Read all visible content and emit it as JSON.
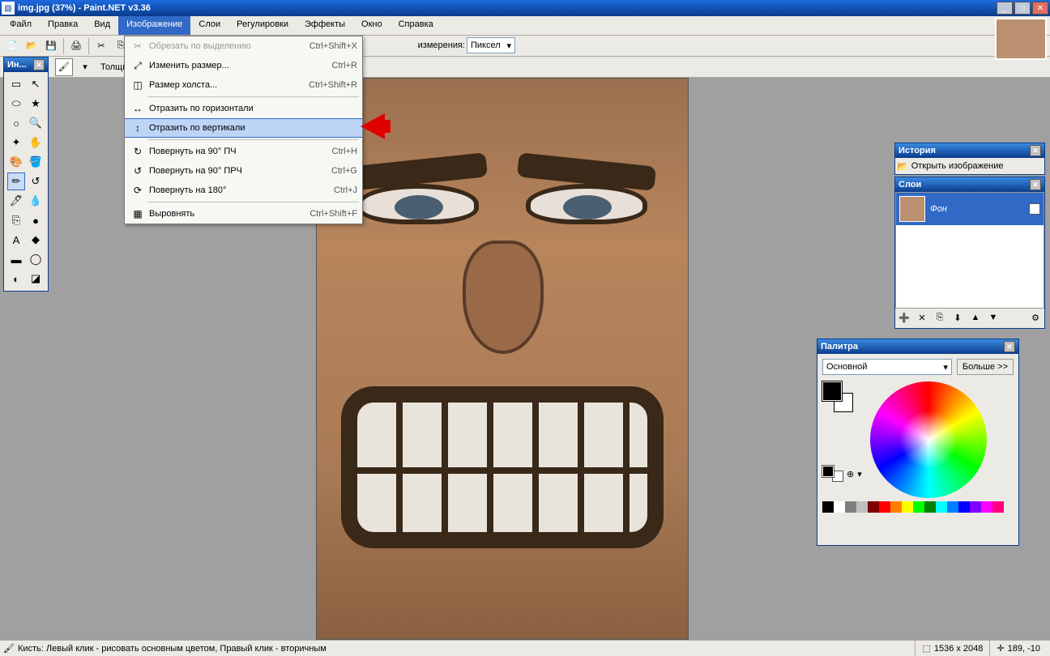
{
  "title": "img.jpg (37%) - Paint.NET v3.36",
  "menubar": [
    "Файл",
    "Правка",
    "Вид",
    "Изображение",
    "Слои",
    "Регулировки",
    "Эффекты",
    "Окно",
    "Справка"
  ],
  "active_menu_index": 3,
  "toolbar": {
    "unit_label": "измерения:",
    "unit_value": "Пиксел"
  },
  "secondbar": {
    "label": "Толщина"
  },
  "tools_panel": {
    "title": "Ин..."
  },
  "tools": [
    "▭",
    "↖",
    "⬭",
    "★",
    "○",
    "🔍",
    "✦",
    "✋",
    "🎨",
    "🪣",
    "✏",
    "↺",
    "🖊",
    "💧",
    "⎘",
    "●",
    "A",
    "◆",
    "▬",
    "◯",
    "◐",
    "◪"
  ],
  "dropdown": {
    "items": [
      {
        "icon": "✂",
        "label": "Обрезать по выделению",
        "shortcut": "Ctrl+Shift+X",
        "disabled": true
      },
      {
        "icon": "⤢",
        "label": "Изменить размер...",
        "shortcut": "Ctrl+R"
      },
      {
        "icon": "◫",
        "label": "Размер холста...",
        "shortcut": "Ctrl+Shift+R"
      },
      {
        "sep": true
      },
      {
        "icon": "↔",
        "label": "Отразить по горизонтали",
        "shortcut": ""
      },
      {
        "icon": "↕",
        "label": "Отразить по вертикали",
        "shortcut": "",
        "highlight": true
      },
      {
        "sep": true
      },
      {
        "icon": "↻",
        "label": "Повернуть на 90° ПЧ",
        "shortcut": "Ctrl+H"
      },
      {
        "icon": "↺",
        "label": "Повернуть на 90° ПРЧ",
        "shortcut": "Ctrl+G"
      },
      {
        "icon": "⟳",
        "label": "Повернуть на 180°",
        "shortcut": "Ctrl+J"
      },
      {
        "sep": true
      },
      {
        "icon": "▦",
        "label": "Выровнять",
        "shortcut": "Ctrl+Shift+F"
      }
    ]
  },
  "history": {
    "title": "История",
    "item": "Открыть изображение"
  },
  "layers": {
    "title": "Слои",
    "item": "Фон"
  },
  "palette": {
    "title": "Палитра",
    "select": "Основной",
    "more": "Больше >>"
  },
  "swatches": [
    "#000000",
    "#ffffff",
    "#7f7f7f",
    "#c0c0c0",
    "#800000",
    "#ff0000",
    "#ff8000",
    "#ffff00",
    "#00ff00",
    "#008000",
    "#00ffff",
    "#0080ff",
    "#0000ff",
    "#8000ff",
    "#ff00ff",
    "#ff0080"
  ],
  "status": {
    "hint": "Кисть: Левый клик - рисовать основным цветом, Правый клик - вторичным",
    "size": "1536 x 2048",
    "coords": "189, -10"
  }
}
